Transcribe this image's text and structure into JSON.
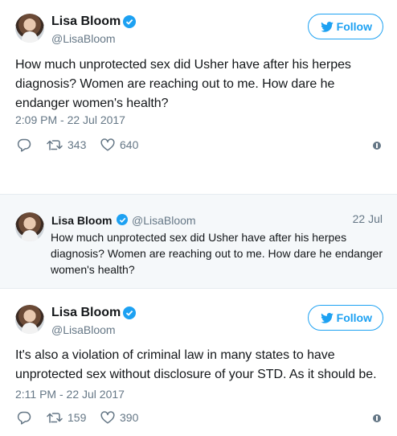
{
  "tweet1": {
    "name": "Lisa Bloom",
    "handle": "@LisaBloom",
    "follow_label": "Follow",
    "text": "How much unprotected sex did Usher have after his herpes diagnosis? Women are reaching out to me. How dare he endanger women's health?",
    "timestamp": "2:09 PM - 22 Jul 2017",
    "retweets": "343",
    "likes": "640"
  },
  "quoted": {
    "name": "Lisa Bloom",
    "handle": "@LisaBloom",
    "date": "22 Jul",
    "text": "How much unprotected sex did Usher have after his herpes diagnosis? Women are reaching out to me. How dare he endanger women's health?"
  },
  "tweet2": {
    "name": "Lisa Bloom",
    "handle": "@LisaBloom",
    "follow_label": "Follow",
    "text": "It's also a violation of criminal law in many states to have unprotected sex without disclosure of your STD. As it should be.",
    "timestamp": "2:11 PM - 22 Jul 2017",
    "retweets": "159",
    "likes": "390"
  },
  "colors": {
    "accent": "#1da1f2",
    "muted": "#657786",
    "quoted_bg": "#f5f8fa"
  },
  "icons": [
    "verified-badge-icon",
    "twitter-bird-icon",
    "reply-icon",
    "retweet-icon",
    "like-icon",
    "info-icon"
  ]
}
